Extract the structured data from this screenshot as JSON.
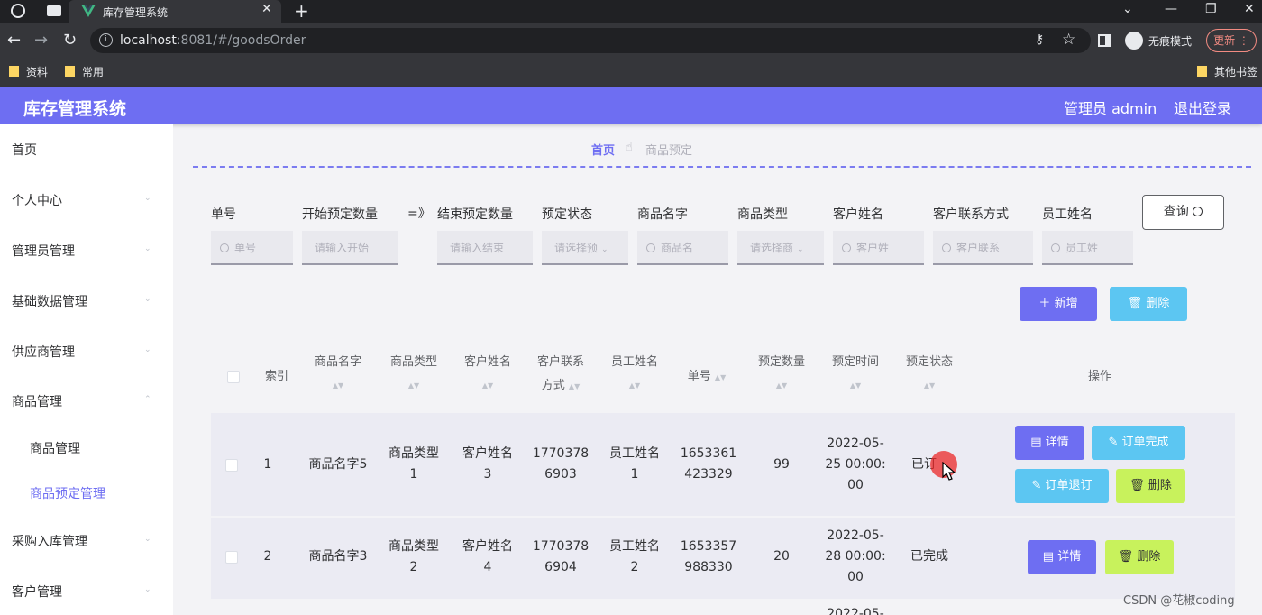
{
  "browser": {
    "tab_title": "库存管理系统",
    "url_host": "localhost",
    "url_rest": ":8081/#/goodsOrder",
    "incognito_label": "无痕模式",
    "update_label": "更新",
    "bookmarks": [
      "资料",
      "常用"
    ],
    "other_bookmarks": "其他书签"
  },
  "app": {
    "title": "库存管理系统",
    "user_label": "管理员 admin",
    "logout_label": "退出登录",
    "accent": "#6e6ef2"
  },
  "sidebar": {
    "items": [
      "首页",
      "个人中心",
      "管理员管理",
      "基础数据管理",
      "供应商管理",
      "商品管理",
      "采购入库管理",
      "客户管理"
    ],
    "subitems": [
      "商品管理",
      "商品预定管理"
    ],
    "active_subitem": "商品预定管理"
  },
  "breadcrumb": {
    "home": "首页",
    "current": "商品预定"
  },
  "filters": {
    "labels": [
      "单号",
      "开始预定数量",
      "结束预定数量",
      "预定状态",
      "商品名字",
      "商品类型",
      "客户姓名",
      "客户联系方式",
      "员工姓名"
    ],
    "range_sep": "=》",
    "placeholders": [
      "单号",
      "请输入开始",
      "请输入结束",
      "请选择预",
      "商品名",
      "请选择商",
      "客户姓",
      "客户联系",
      "员工姓"
    ],
    "query_label": "查询"
  },
  "actions": {
    "add_label": "新增",
    "delete_label": "删除"
  },
  "table": {
    "headers": {
      "index": "索引",
      "goods_name": "商品名字",
      "goods_type": "商品类型",
      "customer_name": "客户姓名",
      "contact_1": "客户联系",
      "contact_2": "方式",
      "staff_name": "员工姓名",
      "order_no": "单号",
      "quantity": "预定数量",
      "time": "预定时间",
      "status": "预定状态",
      "ops": "操作"
    },
    "rows": [
      {
        "index": "1",
        "goods_name": "商品名字5",
        "goods_type": [
          "商品类型",
          "1"
        ],
        "customer_name": [
          "客户姓名",
          "3"
        ],
        "contact": [
          "1770378",
          "6903"
        ],
        "staff_name": [
          "员工姓名",
          "1"
        ],
        "order_no": [
          "1653361",
          "423329"
        ],
        "quantity": "99",
        "time": [
          "2022-05-",
          "25 00:00:",
          "00"
        ],
        "status": "已订",
        "ops": {
          "detail": "详情",
          "complete": "订单完成",
          "cancel": "订单退订",
          "delete": "删除"
        }
      },
      {
        "index": "2",
        "goods_name": "商品名字3",
        "goods_type": [
          "商品类型",
          "2"
        ],
        "customer_name": [
          "客户姓名",
          "4"
        ],
        "contact": [
          "1770378",
          "6904"
        ],
        "staff_name": [
          "员工姓名",
          "2"
        ],
        "order_no": [
          "1653357",
          "988330"
        ],
        "quantity": "20",
        "time": [
          "2022-05-",
          "28 00:00:",
          "00"
        ],
        "status": "已完成",
        "ops": {
          "detail": "详情",
          "delete": "删除"
        }
      }
    ],
    "next_row_partial": "2022-05-"
  },
  "watermark": "CSDN @花椒coding"
}
